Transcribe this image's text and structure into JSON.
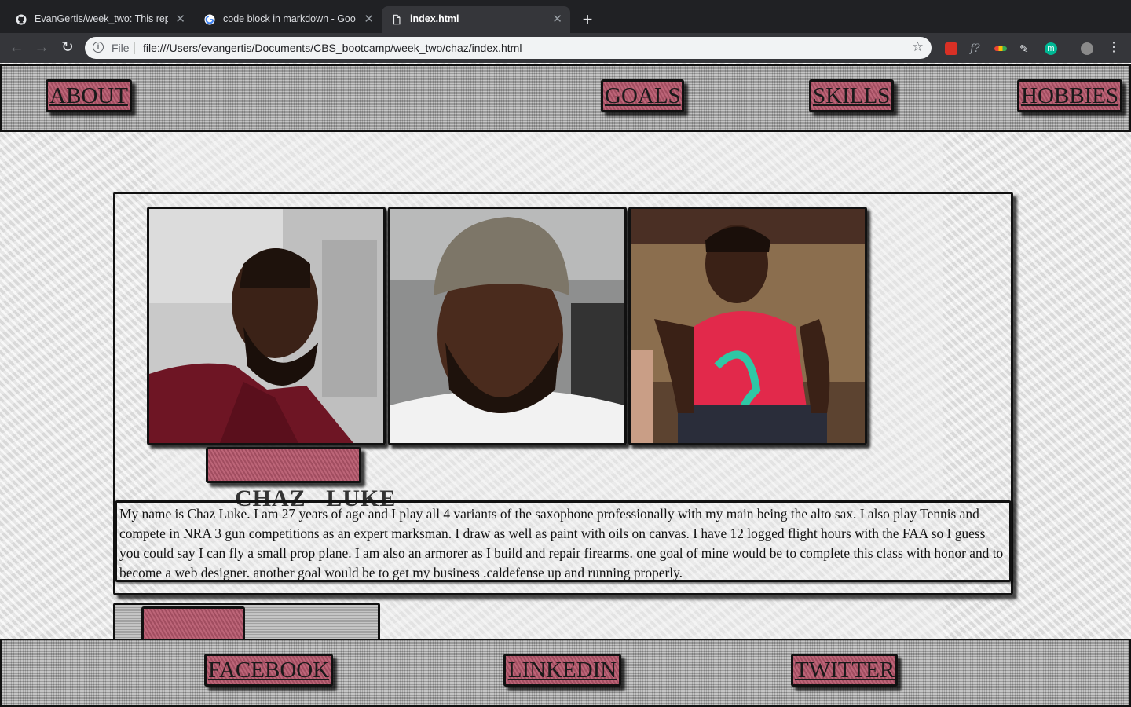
{
  "browser": {
    "tabs": [
      {
        "title": "EvanGertis/week_two: This rep",
        "favicon": "github-icon",
        "active": false
      },
      {
        "title": "code block in markdown - Goo",
        "favicon": "google-icon",
        "active": false
      },
      {
        "title": "index.html",
        "favicon": "file-icon",
        "active": true
      }
    ],
    "address_scheme": "File",
    "address_url": "file:///Users/evangertis/Documents/CBS_bootcamp/week_two/chaz/index.html"
  },
  "nav": {
    "about": "ABOUT",
    "goals": "GOALS",
    "skills": "SKILLS",
    "hobbies": "HOBBIES"
  },
  "profile": {
    "first_name": "CHAZ",
    "last_name": "LUKE",
    "photos": [
      "photo-in-maroon-shirt",
      "photo-in-beanie",
      "photo-in-red-tank-top"
    ],
    "bio": "My name is Chaz Luke. I am 27 years of age and I play all 4 variants of the saxophone professionally with my main being the alto sax. I also play Tennis and compete in NRA 3 gun competitions as an expert marksman. I draw as well as paint with oils on canvas. I have 12 logged flight hours with the FAA so I guess you could say I can fly a small prop plane. I am also an armorer as I build and repair firearms. one goal of mine would be to complete this class with honor and to become a web designer. another goal would be to get my business .caldefense up and running properly."
  },
  "footer": {
    "facebook": "FACEBOOK",
    "linkedin": "LINKEDIN",
    "twitter": "TWITTER"
  },
  "colors": {
    "button": "#b7586d",
    "border": "#111111"
  }
}
